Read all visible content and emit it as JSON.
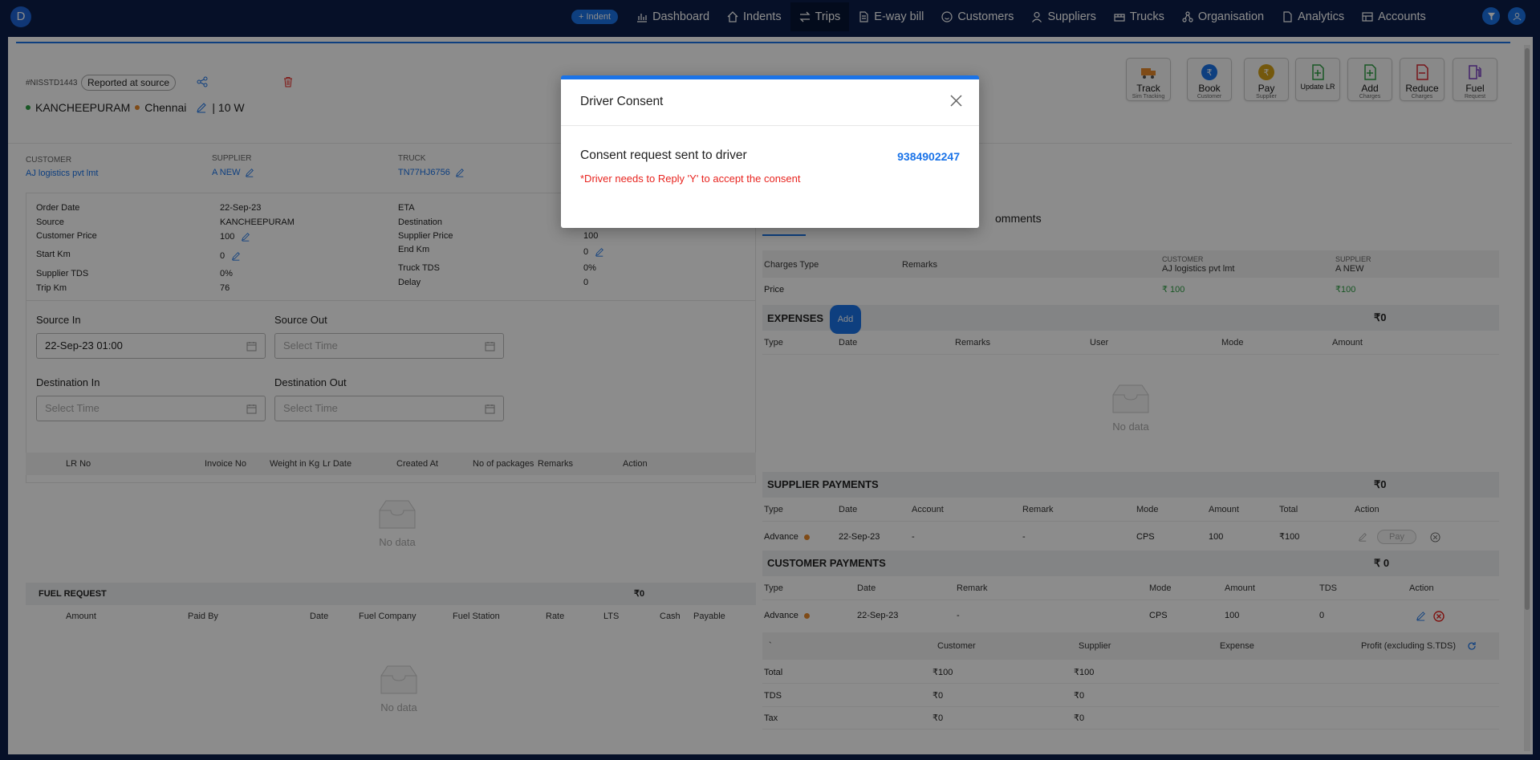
{
  "nav": {
    "avatar_letter": "D",
    "indent_button": "+ Indent",
    "items": [
      {
        "label": "Dashboard",
        "icon": "bar-chart-icon"
      },
      {
        "label": "Indents",
        "icon": "home-icon"
      },
      {
        "label": "Trips",
        "icon": "swap-icon"
      },
      {
        "label": "E-way bill",
        "icon": "file-icon"
      },
      {
        "label": "Customers",
        "icon": "smile-icon"
      },
      {
        "label": "Suppliers",
        "icon": "user-icon"
      },
      {
        "label": "Trucks",
        "icon": "truck-icon"
      },
      {
        "label": "Organisation",
        "icon": "cluster-icon"
      },
      {
        "label": "Analytics",
        "icon": "document-icon"
      },
      {
        "label": "Accounts",
        "icon": "table-icon"
      }
    ],
    "active": "Trips"
  },
  "trip": {
    "id": "#NISSTD1443",
    "status": "Reported at source",
    "source": "KANCHEEPURAM",
    "destination": "Chennai",
    "truck_type": "| 10 W"
  },
  "actions": [
    {
      "label": "Track",
      "sub": "Sim Tracking",
      "color": "#e8892b"
    },
    {
      "label": "Book",
      "sub": "Customer",
      "color": "#1a73e8"
    },
    {
      "label": "Pay",
      "sub": "Supplier",
      "color": "#d4a017"
    },
    {
      "label": "Update LR",
      "sub": "",
      "color": "#2e9e44"
    },
    {
      "label": "Add",
      "sub": "Charges",
      "color": "#2e9e44"
    },
    {
      "label": "Reduce",
      "sub": "Charges",
      "color": "#d8262f"
    },
    {
      "label": "Fuel",
      "sub": "Request",
      "color": "#7a3fc2"
    }
  ],
  "parties": {
    "customer_label": "CUSTOMER",
    "customer": "AJ logistics pvt lmt",
    "supplier_label": "SUPPLIER",
    "supplier": "A NEW",
    "truck_label": "TRUCK",
    "truck": "TN77HJ6756"
  },
  "details": {
    "left": [
      {
        "label": "Order Date",
        "value": "22-Sep-23"
      },
      {
        "label": "Source",
        "value": "KANCHEEPURAM"
      },
      {
        "label": "Customer Price",
        "value": "100"
      },
      {
        "label": "Start Km",
        "value": "0"
      },
      {
        "label": "Supplier TDS",
        "value": "0%"
      },
      {
        "label": "Trip Km",
        "value": "76"
      }
    ],
    "right": [
      {
        "label": "ETA",
        "value": ""
      },
      {
        "label": "Destination",
        "value": ""
      },
      {
        "label": "Supplier Price",
        "value": "100"
      },
      {
        "label": "End Km",
        "value": "0"
      },
      {
        "label": "Truck TDS",
        "value": "0%"
      },
      {
        "label": "Delay",
        "value": "0"
      }
    ]
  },
  "times": {
    "source_in_label": "Source In",
    "source_in": "22-Sep-23 01:00",
    "source_out_label": "Source Out",
    "source_out_ph": "Select Time",
    "dest_in_label": "Destination In",
    "dest_in_ph": "Select Time",
    "dest_out_label": "Destination Out",
    "dest_out_ph": "Select Time"
  },
  "lr_table": {
    "headers": [
      "LR No",
      "Invoice No",
      "Weight in Kg",
      "Lr Date",
      "Created At",
      "No of packages",
      "Remarks",
      "Action"
    ],
    "empty": "No data"
  },
  "fuel": {
    "title": "FUEL REQUEST",
    "total": "₹0",
    "headers": [
      "Amount",
      "Paid By",
      "Date",
      "Fuel Company",
      "Fuel Station",
      "Rate",
      "LTS",
      "Cash",
      "Payable"
    ],
    "empty": "No data"
  },
  "tabs_partial": "omments",
  "charges": {
    "headers": [
      "Charges Type",
      "Remarks"
    ],
    "customer_label": "CUSTOMER",
    "customer_name": "AJ logistics pvt lmt",
    "supplier_label": "SUPPLIER",
    "supplier_name": "A NEW",
    "row": {
      "type": "Price",
      "customer": "₹ 100",
      "supplier": "₹100"
    }
  },
  "expenses": {
    "title": "EXPENSES",
    "add": "Add",
    "total": "₹0",
    "headers": [
      "Type",
      "Date",
      "Remarks",
      "User",
      "Mode",
      "Amount"
    ],
    "empty": "No data"
  },
  "supplier_payments": {
    "title": "SUPPLIER PAYMENTS",
    "total": "₹0",
    "headers": [
      "Type",
      "Date",
      "Account",
      "Remark",
      "Mode",
      "Amount",
      "Total",
      "Action"
    ],
    "row": {
      "type": "Advance",
      "date": "22-Sep-23",
      "account": "-",
      "remark": "-",
      "mode": "CPS",
      "amount": "100",
      "total": "₹100",
      "pay": "Pay"
    }
  },
  "customer_payments": {
    "title": "CUSTOMER PAYMENTS",
    "total": "₹ 0",
    "headers": [
      "Type",
      "Date",
      "Remark",
      "Mode",
      "Amount",
      "TDS",
      "Action"
    ],
    "row": {
      "type": "Advance",
      "date": "22-Sep-23",
      "remark": "-",
      "mode": "CPS",
      "amount": "100",
      "tds": "0"
    }
  },
  "summary": {
    "headers": [
      "`",
      "Customer",
      "Supplier",
      "Expense",
      "Profit (excluding S.TDS)"
    ],
    "rows": [
      {
        "label": "Total",
        "customer": "₹100",
        "supplier": "₹100"
      },
      {
        "label": "TDS",
        "customer": "₹0",
        "supplier": "₹0"
      },
      {
        "label": "Tax",
        "customer": "₹0",
        "supplier": "₹0"
      }
    ]
  },
  "modal": {
    "title": "Driver Consent",
    "message": "Consent request sent to driver",
    "phone": "9384902247",
    "note": "*Driver needs to Reply 'Y' to accept the consent"
  }
}
